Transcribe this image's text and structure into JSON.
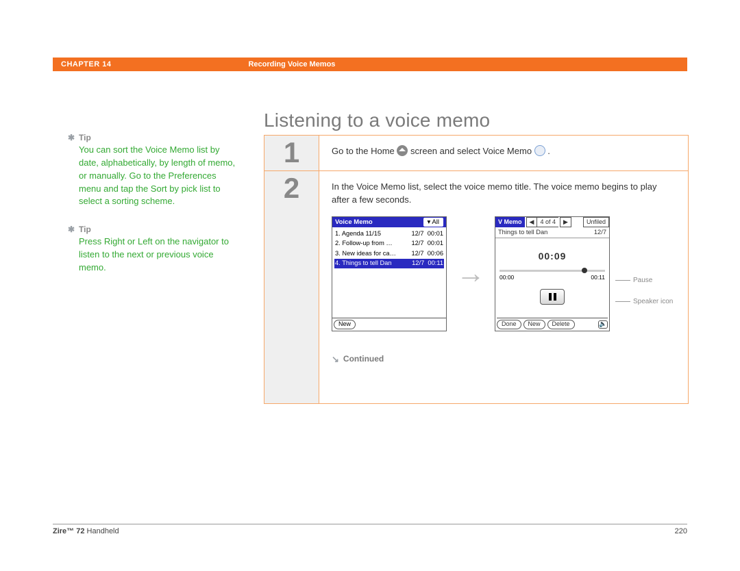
{
  "header": {
    "chapter_label": "CHAPTER 14",
    "section_title": "Recording Voice Memos"
  },
  "sidebar": {
    "tips": [
      {
        "heading": "Tip",
        "body": "You can sort the Voice Memo list by date, alphabetically, by length of memo, or manually. Go to the Preferences menu and tap the Sort by pick list to select a sorting scheme."
      },
      {
        "heading": "Tip",
        "body": "Press Right or Left on the navigator to listen to the next or previous voice memo."
      }
    ]
  },
  "page": {
    "title": "Listening to a voice memo"
  },
  "steps": [
    {
      "num": "1",
      "text_before": "Go to the Home ",
      "text_mid": " screen and select Voice Memo ",
      "text_after": "."
    },
    {
      "num": "2",
      "intro": "In the Voice Memo list, select the voice memo title. The voice memo begins to play after a few seconds.",
      "continued": "Continued",
      "list_screen": {
        "title": "Voice Memo",
        "filter": "▾ All",
        "rows": [
          {
            "n": "1.",
            "name": "Agenda 11/15",
            "date": "12/7",
            "dur": "00:01"
          },
          {
            "n": "2.",
            "name": "Follow-up from …",
            "date": "12/7",
            "dur": "00:01"
          },
          {
            "n": "3.",
            "name": "New ideas for ca…",
            "date": "12/7",
            "dur": "00:06"
          },
          {
            "n": "4.",
            "name": "Things to tell Dan",
            "date": "12/7",
            "dur": "00:11",
            "selected": true
          }
        ],
        "new_btn": "New"
      },
      "play_screen": {
        "title": "V Memo",
        "counter": "4 of 4",
        "category": "Unfiled",
        "item_name": "Things to tell Dan",
        "item_date": "12/7",
        "timer": "00:09",
        "start_time": "00:00",
        "end_time": "00:11",
        "buttons": {
          "done": "Done",
          "new": "New",
          "delete": "Delete"
        },
        "annot_pause": "Pause",
        "annot_speaker": "Speaker icon"
      }
    }
  ],
  "footer": {
    "product_bold": "Zire™ 72",
    "product_rest": " Handheld",
    "page_num": "220"
  }
}
